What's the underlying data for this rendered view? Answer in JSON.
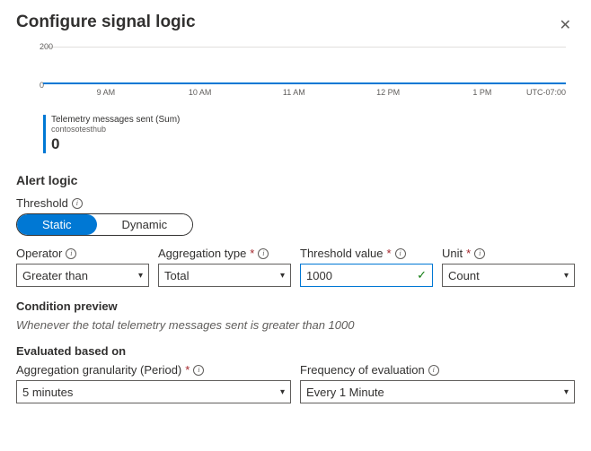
{
  "header": {
    "title": "Configure signal logic"
  },
  "chart_data": {
    "type": "line",
    "ylim": [
      0,
      200
    ],
    "yticks": [
      0,
      200
    ],
    "xticks": [
      "9 AM",
      "10 AM",
      "11 AM",
      "12 PM",
      "1 PM"
    ],
    "tz": "UTC-07:00",
    "series": [
      {
        "name": "Telemetry messages sent (Sum)",
        "resource": "contosotesthub",
        "values": [
          0,
          0,
          0,
          0,
          0
        ],
        "current": "0"
      }
    ]
  },
  "alertLogic": {
    "section_title": "Alert logic",
    "threshold_label": "Threshold",
    "toggle": {
      "static": "Static",
      "dynamic": "Dynamic",
      "active": "Static"
    },
    "operator": {
      "label": "Operator",
      "value": "Greater than"
    },
    "aggType": {
      "label": "Aggregation type",
      "required": true,
      "value": "Total"
    },
    "threshold": {
      "label": "Threshold value",
      "required": true,
      "value": "1000"
    },
    "unit": {
      "label": "Unit",
      "required": true,
      "value": "Count"
    },
    "preview_title": "Condition preview",
    "preview_text": "Whenever the total telemetry messages sent is greater than 1000"
  },
  "evaluation": {
    "section_title": "Evaluated based on",
    "granularity": {
      "label": "Aggregation granularity (Period)",
      "required": true,
      "value": "5 minutes"
    },
    "frequency": {
      "label": "Frequency of evaluation",
      "value": "Every 1 Minute"
    }
  }
}
